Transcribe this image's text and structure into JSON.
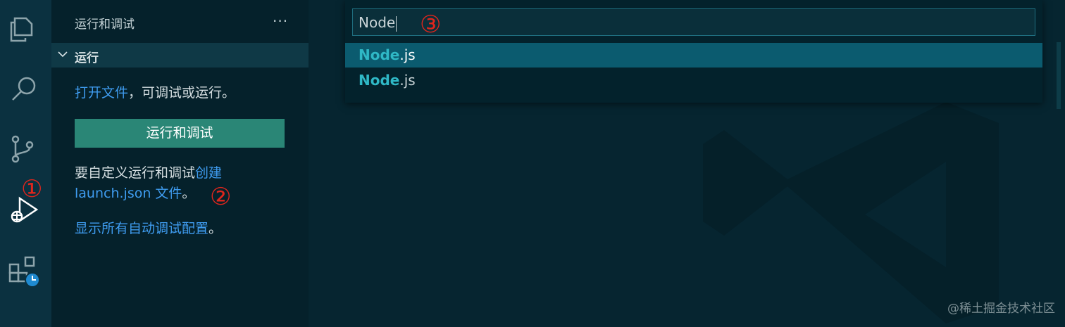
{
  "sidebar": {
    "title": "运行和调试",
    "more": "···",
    "section_label": "运行",
    "open_file_link": "打开文件",
    "open_file_rest": "，可调试或运行。",
    "run_button_label": "运行和调试",
    "customize_text": "要自定义运行和调试",
    "create_link_1": "创建",
    "create_link_2": "launch.json 文件",
    "customize_end": "。",
    "show_all_link": "显示所有自动调试配置",
    "show_all_end": "。"
  },
  "markers": {
    "m1": "①",
    "m2": "②",
    "m3": "③"
  },
  "quick_pick": {
    "input_value": "Node",
    "items": [
      {
        "match": "Node",
        "rest": ".js",
        "selected": true
      },
      {
        "match": "Node",
        "rest": ".js",
        "selected": false
      }
    ]
  },
  "footer": {
    "watermark": "@稀土掘金技术社区"
  },
  "colors": {
    "accent": "#2a8676",
    "link": "#3f9cf0",
    "highlight": "#2fb8c6",
    "marker": "#e0261d"
  },
  "icons": [
    "files-icon",
    "search-icon",
    "source-control-icon",
    "run-debug-icon",
    "extensions-icon",
    "clock-badge-icon"
  ]
}
